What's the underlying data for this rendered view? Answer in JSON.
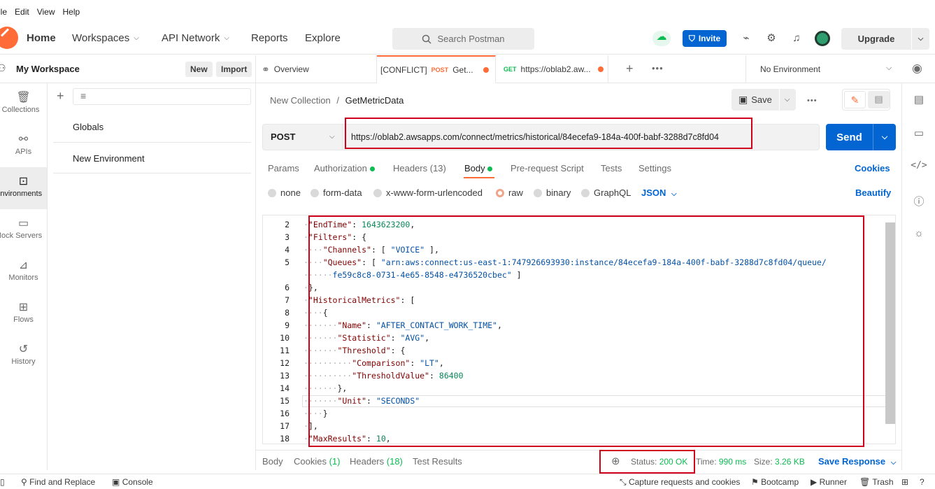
{
  "menubar": {
    "items": [
      "ile",
      "Edit",
      "View",
      "Help"
    ]
  },
  "topbar": {
    "home": "Home",
    "workspaces": "Workspaces",
    "api_network": "API Network",
    "reports": "Reports",
    "explore": "Explore",
    "search_placeholder": "Search Postman",
    "invite": "Invite",
    "upgrade": "Upgrade"
  },
  "workspace": {
    "name": "My Workspace",
    "new": "New",
    "import": "Import"
  },
  "leftnav": [
    {
      "label": "Collections",
      "icon": "collections-icon"
    },
    {
      "label": "APIs",
      "icon": "apis-icon"
    },
    {
      "label": "Environments",
      "icon": "environments-icon"
    },
    {
      "label": "Mock Servers",
      "icon": "mock-servers-icon"
    },
    {
      "label": "Monitors",
      "icon": "monitors-icon"
    },
    {
      "label": "Flows",
      "icon": "flows-icon"
    },
    {
      "label": "History",
      "icon": "history-icon"
    }
  ],
  "environments": {
    "globals": "Globals",
    "items": [
      "New Environment"
    ]
  },
  "tabs": {
    "overview": "Overview",
    "tab1_prefix": "[CONFLICT]",
    "tab1_method": "POST",
    "tab1_name": "Get...",
    "tab2_method": "GET",
    "tab2_name": "https://oblab2.aw...",
    "environment": "No Environment"
  },
  "breadcrumb": {
    "collection": "New Collection",
    "sep": "/",
    "request": "GetMetricData"
  },
  "save": "Save",
  "request": {
    "method": "POST",
    "url": "https://oblab2.awsapps.com/connect/metrics/historical/84ecefa9-184a-400f-babf-3288d7c8fd04",
    "send": "Send"
  },
  "req_tabs": {
    "params": "Params",
    "authorization": "Authorization",
    "headers": "Headers (13)",
    "body": "Body",
    "prerequest": "Pre-request Script",
    "tests": "Tests",
    "settings": "Settings",
    "cookies": "Cookies"
  },
  "body_options": {
    "none": "none",
    "form_data": "form-data",
    "urlencoded": "x-www-form-urlencoded",
    "raw": "raw",
    "binary": "binary",
    "graphql": "GraphQL",
    "json": "JSON",
    "beautify": "Beautify",
    "selected": "raw"
  },
  "code_lines": [
    "2",
    "3",
    "4",
    "5",
    "",
    "6",
    "7",
    "8",
    "9",
    "10",
    "11",
    "12",
    "13",
    "14",
    "15",
    "16",
    "17",
    "18"
  ],
  "response": {
    "body": "Body",
    "cookies": "Cookies",
    "cookies_count": "(1)",
    "headers": "Headers",
    "headers_count": "(18)",
    "test_results": "Test Results",
    "status_label": "Status:",
    "status_value": "200 OK",
    "time_label": "Time:",
    "time_value": "990 ms",
    "size_label": "Size:",
    "size_value": "3.26 KB",
    "save_response": "Save Response"
  },
  "footer": {
    "find_replace": "Find and Replace",
    "console": "Console",
    "capture": "Capture requests and cookies",
    "bootcamp": "Bootcamp",
    "runner": "Runner",
    "trash": "Trash"
  },
  "colors": {
    "accent": "#ff6c37",
    "primary": "#0265d2",
    "success": "#0cbb52",
    "highlight": "#d0021b"
  }
}
